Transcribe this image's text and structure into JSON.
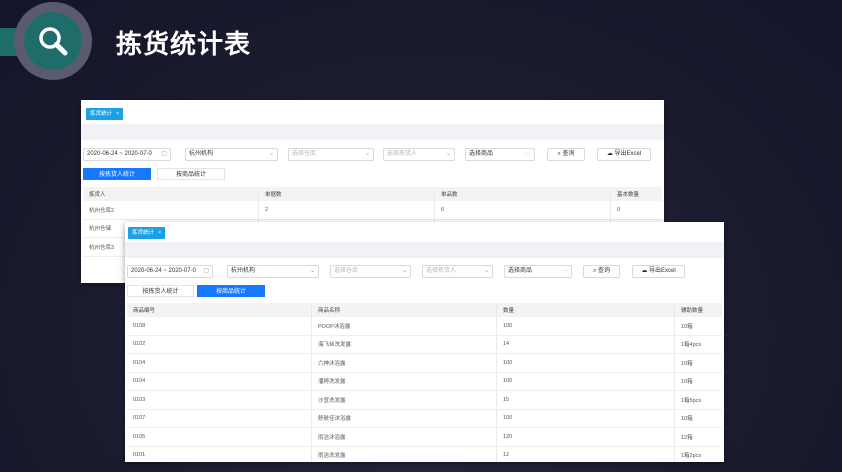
{
  "slide": {
    "title": "拣货统计表"
  },
  "shot1": {
    "tab": "拣货统计",
    "date_range": "2020-06-24 ~ 2020-07-0",
    "org": "杭州机构",
    "warehouse_ph": "选择仓库",
    "picker_ph": "选择拣货人",
    "goods": "选择商品",
    "search": "查询",
    "export": "导出Excel",
    "seg": [
      "按拣货人统计",
      "按商品统计"
    ],
    "columns": [
      "拣货人",
      "单据数",
      "单品数",
      "基本数量"
    ],
    "rows": [
      [
        "杭州仓库2",
        "2",
        "6",
        "0"
      ],
      [
        "杭州仓储",
        "",
        "",
        ""
      ],
      [
        "杭州仓库3",
        "",
        "",
        ""
      ]
    ]
  },
  "shot2": {
    "tab": "拣货统计",
    "date_range": "2020-06-24 ~ 2020-07-0",
    "org": "杭州机构",
    "warehouse_ph": "选择仓库",
    "picker_ph": "选择拣货人",
    "goods": "选择商品",
    "search": "查询",
    "export": "导出Excel",
    "seg": [
      "按拣货人统计",
      "按商品统计"
    ],
    "columns": [
      "商品编号",
      "商品名称",
      "数量",
      "辅助数量"
    ],
    "rows": [
      [
        "0108",
        "POOP沐浴露",
        "100",
        "10箱"
      ],
      [
        "0102",
        "海飞丝洗发露",
        "14",
        "1箱4pcs"
      ],
      [
        "0104",
        "六神沐浴露",
        "100",
        "10箱"
      ],
      [
        "0104",
        "潘婷洗发露",
        "100",
        "10箱"
      ],
      [
        "0103",
        "沙宣洗发露",
        "15",
        "1箱5pcs"
      ],
      [
        "0107",
        "舒肤佳沐浴露",
        "100",
        "10箱"
      ],
      [
        "0105",
        "雨洁沐浴露",
        "120",
        "12箱"
      ],
      [
        "0101",
        "雨洁洗发露",
        "12",
        "1箱2pcs"
      ]
    ]
  }
}
